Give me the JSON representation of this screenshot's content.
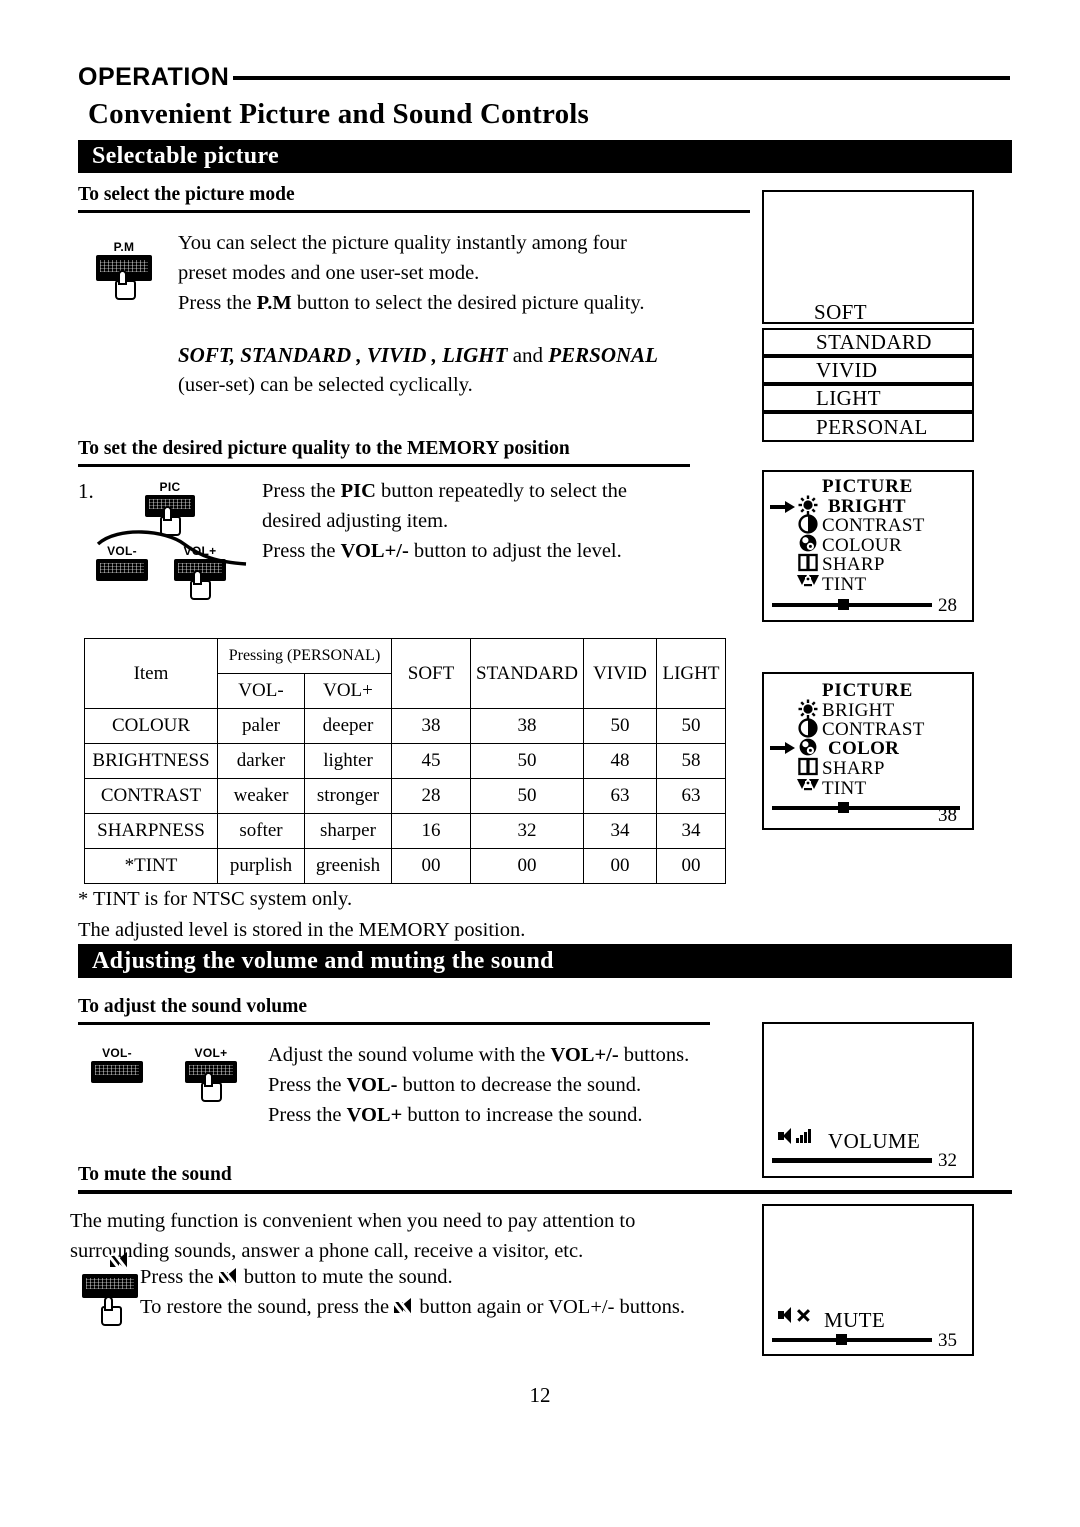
{
  "header": {
    "operation_label": "OPERATION",
    "doc_title": "Convenient Picture and Sound Controls"
  },
  "sections": {
    "selectable_picture": "Selectable picture",
    "volume_mute": "Adjusting the volume and muting the sound"
  },
  "picture_mode": {
    "subhead": "To  select the picture mode",
    "body_line1": "You can select the picture quality instantly among four",
    "body_line2": "preset modes and one user-set mode.",
    "body_line3_pre": "Press the ",
    "body_line3_bold": "P.M",
    "body_line3_post": " button to select the desired picture quality.",
    "modes_italic": "SOFT, STANDARD , VIVID , LIGHT",
    "modes_and": " and ",
    "modes_italic2": "PERSONAL",
    "modes_note": "(user-set) can be selected cyclically.",
    "remote_button_label": "P.M"
  },
  "osd_modes": [
    {
      "label": "SOFT"
    },
    {
      "label": "STANDARD"
    },
    {
      "label": "VIVID"
    },
    {
      "label": "LIGHT"
    },
    {
      "label": "PERSONAL"
    }
  ],
  "memory_position": {
    "subhead": "To set the desired picture quality to the MEMORY position",
    "step_number": "1.",
    "line1_pre": "Press the ",
    "line1_bold": "PIC",
    "line1_post": " button repeatedly to select the",
    "line2": "desired adjusting item.",
    "line3_pre": "Press the ",
    "line3_bold": "VOL+/-",
    "line3_post": " button to adjust the level.",
    "buttons": {
      "pic": "PIC",
      "vol_minus": "VOL-",
      "vol_plus": "VOL+"
    }
  },
  "osd_picture_bright": {
    "title": "PICTURE",
    "items": [
      {
        "label": "BRIGHT",
        "icon": "sun-icon",
        "selected": true
      },
      {
        "label": "CONTRAST",
        "icon": "contrast-icon",
        "selected": false
      },
      {
        "label": "COLOUR",
        "icon": "colour-icon",
        "selected": false
      },
      {
        "label": "SHARP",
        "icon": "sharpness-icon",
        "selected": false
      },
      {
        "label": "TINT",
        "icon": "tint-icon",
        "selected": false
      }
    ],
    "value": "28",
    "slider_percent": 44
  },
  "osd_picture_color": {
    "title": "PICTURE",
    "items": [
      {
        "label": "BRIGHT",
        "icon": "sun-icon",
        "selected": false
      },
      {
        "label": "CONTRAST",
        "icon": "contrast-icon",
        "selected": false
      },
      {
        "label": "COLOR",
        "icon": "colour-icon",
        "selected": true
      },
      {
        "label": "SHARP",
        "icon": "sharpness-icon",
        "selected": false
      },
      {
        "label": "TINT",
        "icon": "tint-icon",
        "selected": false
      }
    ],
    "value": "38",
    "slider_percent": 30
  },
  "comparison_table": {
    "col_item": "Item",
    "col_pressing": "Pressing (PERSONAL)",
    "col_vol_minus": "VOL-",
    "col_vol_plus": "VOL+",
    "col_soft": "SOFT",
    "col_standard": "STANDARD",
    "col_vivid": "VIVID",
    "col_light": "LIGHT",
    "rows": [
      {
        "item": "COLOUR",
        "vol_minus": "paler",
        "vol_plus": "deeper",
        "soft": "38",
        "standard": "38",
        "vivid": "50",
        "light": "50"
      },
      {
        "item": "BRIGHTNESS",
        "vol_minus": "darker",
        "vol_plus": "lighter",
        "soft": "45",
        "standard": "50",
        "vivid": "48",
        "light": "58"
      },
      {
        "item": "CONTRAST",
        "vol_minus": "weaker",
        "vol_plus": "stronger",
        "soft": "28",
        "standard": "50",
        "vivid": "63",
        "light": "63"
      },
      {
        "item": "SHARPNESS",
        "vol_minus": "softer",
        "vol_plus": "sharper",
        "soft": "16",
        "standard": "32",
        "vivid": "34",
        "light": "34"
      },
      {
        "item": "*TINT",
        "vol_minus": "purplish",
        "vol_plus": "greenish",
        "soft": "00",
        "standard": "00",
        "vivid": "00",
        "light": "00"
      }
    ]
  },
  "footnotes": {
    "line1": "* TINT is for NTSC system only.",
    "line2": "The adjusted level is stored in the MEMORY position."
  },
  "sound_volume": {
    "subhead": "To adjust the sound volume",
    "line1_pre": "Adjust the sound volume with the ",
    "line1_bold": "VOL+/-",
    "line1_post": " buttons.",
    "line2_pre": "Press the ",
    "line2_bold": "VOL-",
    "line2_post": " button to decrease the sound.",
    "line3_pre": "Press the ",
    "line3_bold": "VOL+",
    "line3_post": " button to increase the sound.",
    "buttons": {
      "vol_minus": "VOL-",
      "vol_plus": "VOL+"
    }
  },
  "osd_volume": {
    "label": "VOLUME",
    "value": "32",
    "slider_percent": 100
  },
  "mute": {
    "subhead": "To mute the sound",
    "intro_line1": "The muting function is convenient when you need to pay attention to",
    "intro_line2": "surrounding sounds, answer a phone call, receive a visitor, etc.",
    "line1_pre": "Press the ",
    "line1_post": " button to mute the sound.",
    "line2_pre": "To restore the sound, press the ",
    "line2_post": " button again or VOL+/- buttons."
  },
  "osd_mute": {
    "label": "MUTE",
    "value": "35",
    "slider_percent": 44
  },
  "page_number": "12"
}
